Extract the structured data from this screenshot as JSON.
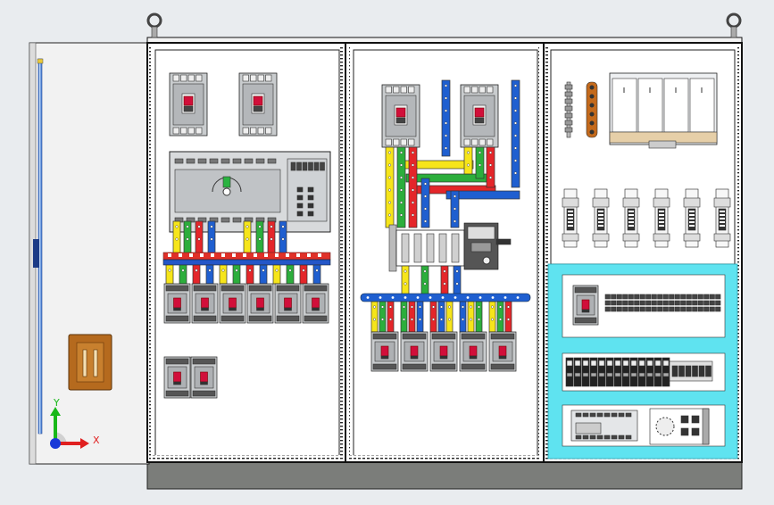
{
  "triad": {
    "x_label": "X",
    "y_label": "Y"
  },
  "colors": {
    "background": "#e9ecef",
    "cabinet_frame": "#111111",
    "panel": "#ffffff",
    "door": "#f2f2f2",
    "breaker_body": "#c9ccce",
    "breaker_handle": "#d10f3a",
    "plc_body": "#d8dadc",
    "busbar_yellow": "#f6e51a",
    "busbar_green": "#2cae3c",
    "busbar_red": "#e4262a",
    "busbar_blue": "#1f5fd0",
    "rail_red": "#e03028",
    "rail_blue": "#2456c8",
    "cyan_frame": "#5fe3f0",
    "plinth": "#7b7d7a",
    "door_handle": "#b56a1e",
    "triad_x": "#e02020",
    "triad_y": "#18b818",
    "triad_z": "#1a3ad8"
  },
  "icons": {
    "lifting_eye": "lifting-eye-icon",
    "triad": "coordinate-triad-icon"
  }
}
